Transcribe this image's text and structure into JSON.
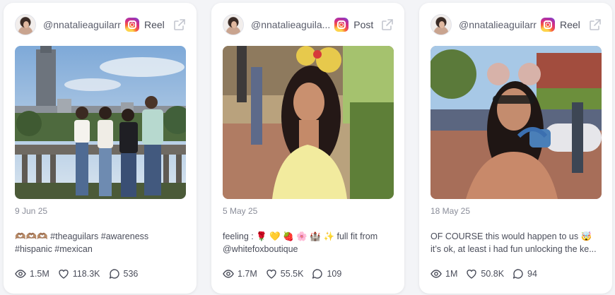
{
  "cards": [
    {
      "handle": "@nnatalieaguilarr",
      "post_type": "Reel",
      "date": "9 Jun 25",
      "caption_line1": "🫶🏽🫶🏽🫶🏽 #theaguilars #awareness",
      "caption_line2": "#hispanic #mexican",
      "views": "1.5M",
      "likes": "118.3K",
      "comments": "536"
    },
    {
      "handle": "@nnatalieaguila...",
      "post_type": "Post",
      "date": "5 May 25",
      "caption_line1": "feeling : 🌹 💛 🍓 🌸 🏰 ✨ full fit from",
      "caption_line2": "@whitefoxboutique",
      "views": "1.7M",
      "likes": "55.5K",
      "comments": "109"
    },
    {
      "handle": "@nnatalieaguilarr",
      "post_type": "Reel",
      "date": "18 May 25",
      "caption_line1": "OF COURSE this would happen to us 🤯",
      "caption_line2": "it’s ok, at least i had fun unlocking the ke...",
      "views": "1M",
      "likes": "50.8K",
      "comments": "94"
    }
  ],
  "icons": {
    "platform": "instagram-icon",
    "open": "external-link-icon",
    "views": "eye-icon",
    "likes": "heart-icon",
    "comments": "comment-icon"
  },
  "colors": {
    "background": "#f3f4f7",
    "card": "#ffffff",
    "text": "#4a4d5a",
    "muted": "#8a8d99"
  }
}
